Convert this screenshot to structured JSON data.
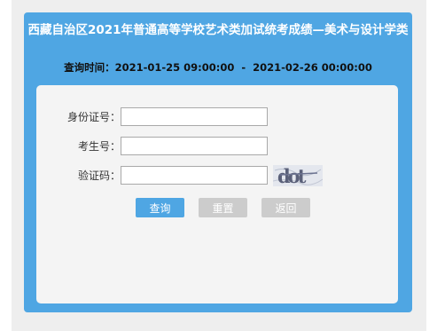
{
  "header": {
    "title": "西藏自治区2021年普通高等学校艺术类加试统考成绩—美术与设计学类",
    "time_label": "查询时间：",
    "time_start": "2021-01-25 09:00:00",
    "time_separator": "-",
    "time_end": "2021-02-26 00:00:00"
  },
  "form": {
    "id_label": "身份证号：",
    "id_value": "",
    "exam_label": "考生号：",
    "exam_value": "",
    "captcha_label": "验证码：",
    "captcha_value": "",
    "captcha_text": "dot"
  },
  "buttons": {
    "query": "查询",
    "reset": "重置",
    "back": "返回"
  },
  "colors": {
    "primary": "#4fa6e3",
    "disabled": "#cccccc",
    "card_bg": "#f4f4f4"
  }
}
